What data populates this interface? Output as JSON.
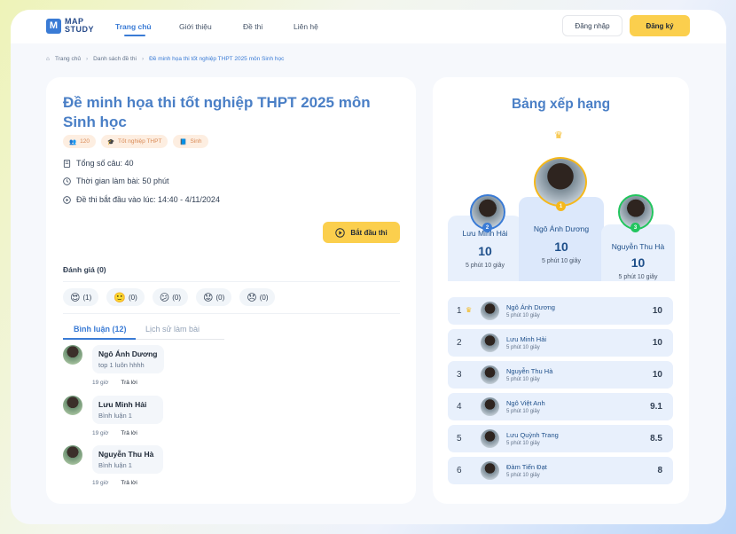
{
  "logo": {
    "mark": "M",
    "line1": "MAP",
    "line2": "STUDY"
  },
  "nav": [
    {
      "label": "Trang chủ",
      "active": true
    },
    {
      "label": "Giới thiệu",
      "active": false
    },
    {
      "label": "Đề thi",
      "active": false
    },
    {
      "label": "Liên hệ",
      "active": false
    }
  ],
  "auth": {
    "login": "Đăng nhập",
    "register": "Đăng ký"
  },
  "breadcrumb": [
    "Trang chủ",
    "Danh sách đề thi",
    "Đề minh họa thi tốt nghiệp THPT 2025 môn Sinh học"
  ],
  "exam": {
    "title": "Đề minh họa thi tốt nghiệp THPT 2025 môn Sinh học",
    "tags": [
      "120",
      "Tốt nghiệp THPT",
      "Sinh"
    ],
    "questions": "Tổng số câu: 40",
    "duration": "Thời gian làm bài: 50 phút",
    "start_time": "Đề thi bắt đầu vào lúc: 14:40 - 4/11/2024",
    "start_button": "Bắt đầu thi"
  },
  "rating": {
    "label": "Đánh giá (0)",
    "reactions": [
      {
        "emoji": "😍",
        "count": "(1)"
      },
      {
        "emoji": "🙂",
        "count": "(0)"
      },
      {
        "emoji": "😕",
        "count": "(0)"
      },
      {
        "emoji": "😟",
        "count": "(0)"
      },
      {
        "emoji": "😞",
        "count": "(0)"
      }
    ]
  },
  "tabs": {
    "comments": "Bình luận (12)",
    "history": "Lịch sử làm bài"
  },
  "comments": [
    {
      "name": "Ngô Ánh Dương",
      "text": "top 1 luôn hhhh",
      "time": "19 giờ",
      "reply": "Trả lời"
    },
    {
      "name": "Lưu Minh Hải",
      "text": "Bình luận 1",
      "time": "19 giờ",
      "reply": "Trả lời"
    },
    {
      "name": "Nguyễn Thu Hà",
      "text": "Bình luận 1",
      "time": "19 giờ",
      "reply": "Trả lời"
    }
  ],
  "leaderboard": {
    "title": "Bảng xếp hạng",
    "podium": [
      {
        "rank": "2",
        "name": "Lưu Minh Hải",
        "score": "10",
        "time": "5 phút 10 giây",
        "color": "#3a7bd5"
      },
      {
        "rank": "1",
        "name": "Ngô Ánh Dương",
        "score": "10",
        "time": "5 phút 10 giây",
        "color": "#f5b81b"
      },
      {
        "rank": "3",
        "name": "Nguyễn Thu Hà",
        "score": "10",
        "time": "5 phút 10 giây",
        "color": "#22c55e"
      }
    ],
    "rows": [
      {
        "rank": "1",
        "name": "Ngô Ánh Dương",
        "time": "5 phút 10 giây",
        "score": "10"
      },
      {
        "rank": "2",
        "name": "Lưu Minh Hải",
        "time": "5 phút 10 giây",
        "score": "10"
      },
      {
        "rank": "3",
        "name": "Nguyễn Thu Hà",
        "time": "5 phút 10 giây",
        "score": "10"
      },
      {
        "rank": "4",
        "name": "Ngô Việt Anh",
        "time": "5 phút 10 giây",
        "score": "9.1"
      },
      {
        "rank": "5",
        "name": "Lưu Quỳnh Trang",
        "time": "5 phút 10 giây",
        "score": "8.5"
      },
      {
        "rank": "6",
        "name": "Đàm Tiến Đạt",
        "time": "5 phút 10 giây",
        "score": "8"
      }
    ]
  }
}
